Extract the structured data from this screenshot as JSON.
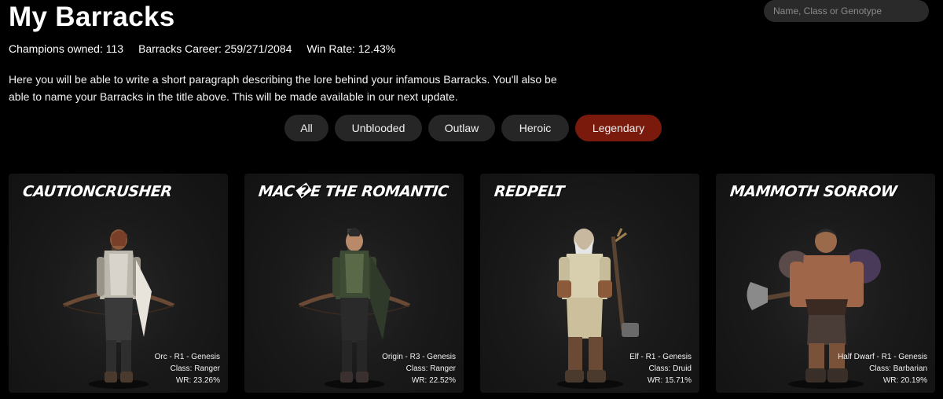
{
  "header": {
    "title": "My Barracks",
    "search_placeholder": "Name, Class or Genotype"
  },
  "stats": {
    "champions_owned": "Champions owned: 113",
    "career": "Barracks Career: 259/271/2084",
    "win_rate": "Win Rate: 12.43%"
  },
  "description": "Here you will be able to write a short paragraph describing the lore behind your infamous Barracks. You'll also be able to name your Barracks in the title above. This will be made available in our next update.",
  "filters": [
    {
      "label": "All",
      "active": false
    },
    {
      "label": "Unblooded",
      "active": false
    },
    {
      "label": "Outlaw",
      "active": false
    },
    {
      "label": "Heroic",
      "active": false
    },
    {
      "label": "Legendary",
      "active": true
    }
  ],
  "colors": {
    "background": "#000000",
    "card": "#1a1a1a",
    "pill": "#262626",
    "pill_active": "#7a1a0c"
  },
  "cards": [
    {
      "name": "CAUTIONCRUSHER",
      "line1": "Orc - R1 - Genesis",
      "line2": "Class: Ranger",
      "line3": "WR: 23.26%",
      "figure": "ranger-orc-figure"
    },
    {
      "name": "MAC�E THE ROMANTIC",
      "line1": "Origin - R3 - Genesis",
      "line2": "Class: Ranger",
      "line3": "WR: 22.52%",
      "figure": "ranger-origin-figure"
    },
    {
      "name": "REDPELT",
      "line1": "Elf - R1 - Genesis",
      "line2": "Class: Druid",
      "line3": "WR: 15.71%",
      "figure": "druid-elf-figure"
    },
    {
      "name": "MAMMOTH SORROW",
      "line1": "Half Dwarf - R1 - Genesis",
      "line2": "Class: Barbarian",
      "line3": "WR: 20.19%",
      "figure": "barbarian-half-dwarf-figure"
    }
  ]
}
